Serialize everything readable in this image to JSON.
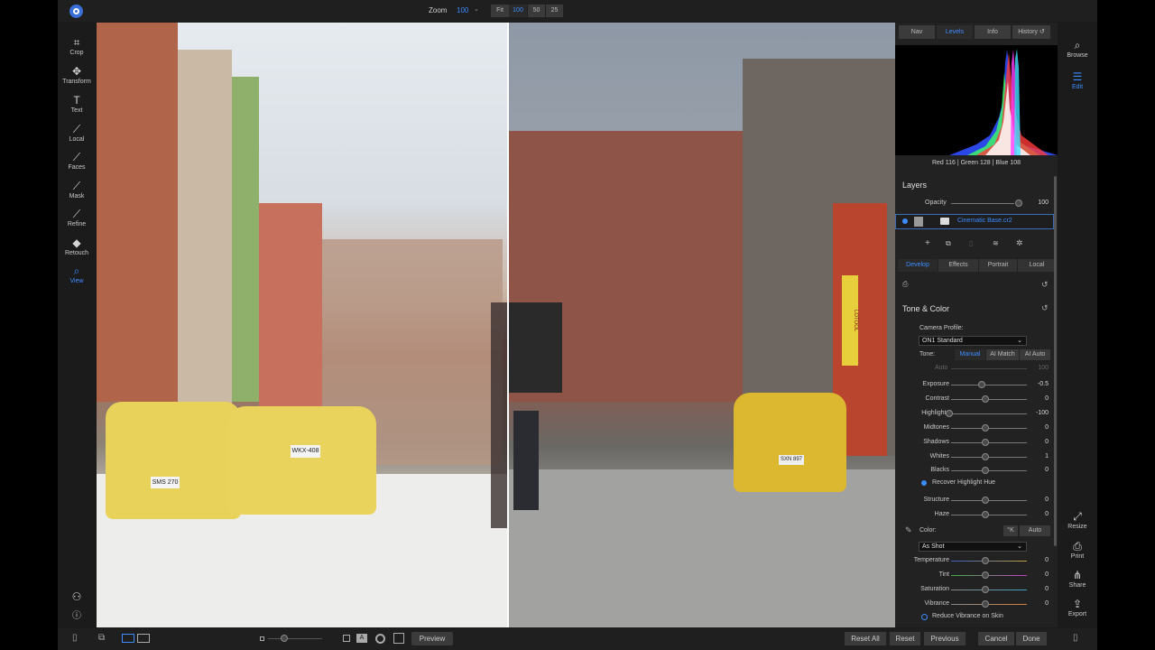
{
  "topbar": {
    "zoom_label": "Zoom",
    "zoom_value": "100",
    "zoom_buttons": [
      "Fit",
      "100",
      "50",
      "25"
    ]
  },
  "left_tools": [
    "Crop",
    "Transform",
    "Text",
    "Local",
    "Faces",
    "Mask",
    "Refine",
    "Retouch",
    "View"
  ],
  "right_tools": {
    "top": [
      "Browse",
      "Edit"
    ],
    "bottom": [
      "Resize",
      "Print",
      "Share",
      "Export"
    ]
  },
  "panel": {
    "tabs": [
      "Nav",
      "Levels",
      "Info",
      "History"
    ],
    "rgb_readout": "Red 116 | Green 128 | Blue 108",
    "layers_title": "Layers",
    "opacity_label": "Opacity",
    "opacity_value": "100",
    "layer_name": "Cinematic Base.cr2",
    "module_tabs": [
      "Develop",
      "Effects",
      "Portrait",
      "Local"
    ],
    "tone_title": "Tone & Color",
    "camera_profile_label": "Camera Profile:",
    "camera_profile_value": "ON1 Standard",
    "tone_label": "Tone:",
    "tone_modes": [
      "Manual",
      "AI Match",
      "AI Auto"
    ],
    "auto_label": "Auto",
    "auto_value": "100",
    "sliders": [
      {
        "label": "Exposure",
        "value": "-0.5"
      },
      {
        "label": "Contrast",
        "value": "0"
      },
      {
        "label": "Highlights",
        "value": "-100"
      },
      {
        "label": "Midtones",
        "value": "0"
      },
      {
        "label": "Shadows",
        "value": "0"
      },
      {
        "label": "Whites",
        "value": "1"
      },
      {
        "label": "Blacks",
        "value": "0"
      }
    ],
    "recover_label": "Recover Highlight Hue",
    "sliders2": [
      {
        "label": "Structure",
        "value": "0"
      },
      {
        "label": "Haze",
        "value": "0"
      }
    ],
    "color_label": "Color:",
    "color_k": "°K",
    "color_auto": "Auto",
    "wb_value": "As Shot",
    "sliders3": [
      {
        "label": "Temperature",
        "value": "0"
      },
      {
        "label": "Tint",
        "value": "0"
      },
      {
        "label": "Saturation",
        "value": "0"
      },
      {
        "label": "Vibrance",
        "value": "0"
      }
    ],
    "reduce_label": "Reduce Vibrance on Skin"
  },
  "bottom": {
    "preview": "Preview",
    "reset_all": "Reset All",
    "reset": "Reset",
    "previous": "Previous",
    "cancel": "Cancel",
    "done": "Done"
  },
  "photo_signs": {
    "plate_left": "SMS 270",
    "plate_mid": "WKX-408",
    "plate_right": "SXN 897",
    "vertical_sign": "LOTOOL"
  }
}
